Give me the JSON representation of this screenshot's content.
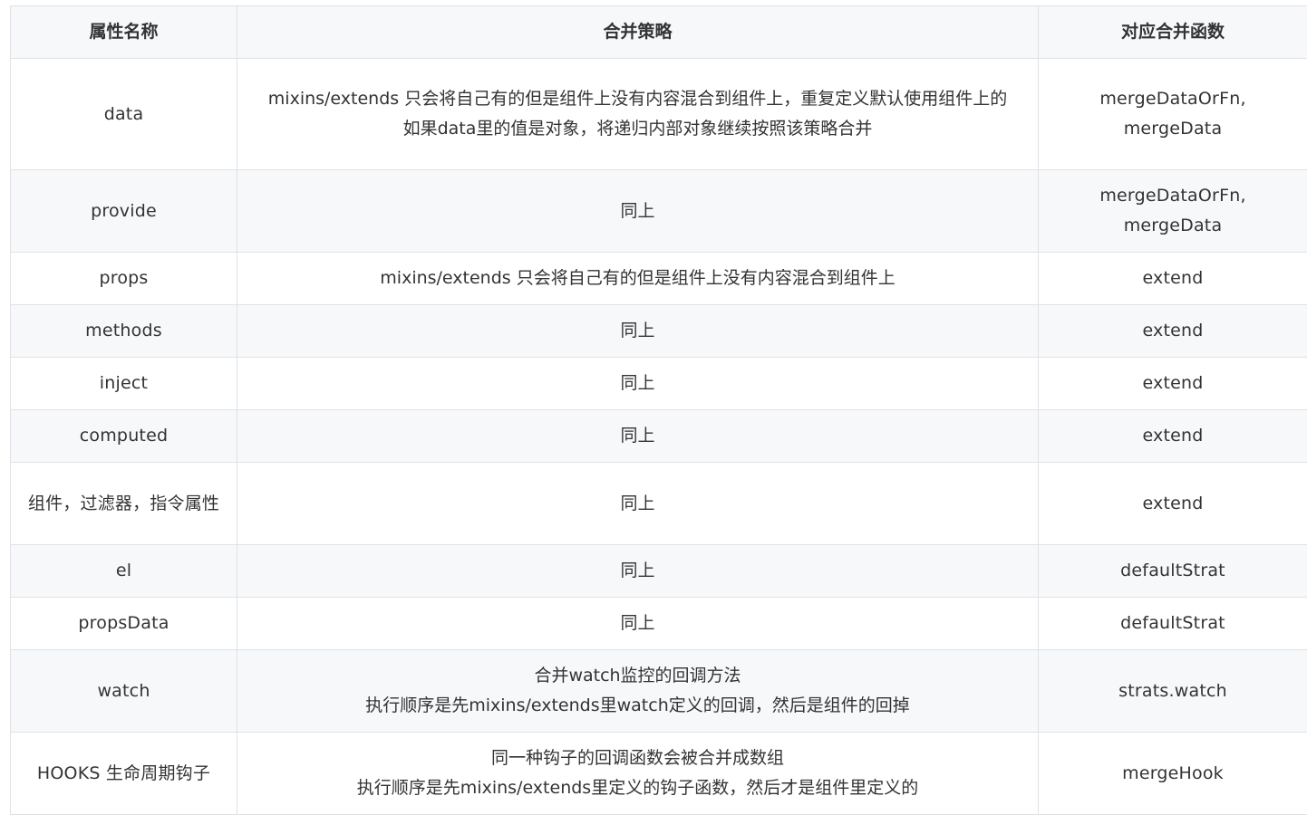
{
  "table": {
    "headers": [
      "属性名称",
      "合并策略",
      "对应合并函数"
    ],
    "rows": [
      {
        "name": "data",
        "strategy": [
          "mixins/extends 只会将自己有的但是组件上没有内容混合到组件上，重复定义默认使用组件上的",
          "如果data里的值是对象，将递归内部对象继续按照该策略合并"
        ],
        "fn": [
          "mergeDataOrFn,",
          "mergeData"
        ]
      },
      {
        "name": "provide",
        "strategy": [
          "同上"
        ],
        "fn": [
          "mergeDataOrFn,",
          "mergeData"
        ]
      },
      {
        "name": "props",
        "strategy": [
          "mixins/extends 只会将自己有的但是组件上没有内容混合到组件上"
        ],
        "fn": [
          "extend"
        ]
      },
      {
        "name": "methods",
        "strategy": [
          "同上"
        ],
        "fn": [
          "extend"
        ]
      },
      {
        "name": "inject",
        "strategy": [
          "同上"
        ],
        "fn": [
          "extend"
        ]
      },
      {
        "name": "computed",
        "strategy": [
          "同上"
        ],
        "fn": [
          "extend"
        ]
      },
      {
        "name": "组件，过滤器，指令属性",
        "strategy": [
          "同上"
        ],
        "fn": [
          "extend"
        ]
      },
      {
        "name": "el",
        "strategy": [
          "同上"
        ],
        "fn": [
          "defaultStrat"
        ]
      },
      {
        "name": "propsData",
        "strategy": [
          "同上"
        ],
        "fn": [
          "defaultStrat"
        ]
      },
      {
        "name": "watch",
        "strategy": [
          "合并watch监控的回调方法",
          "执行顺序是先mixins/extends里watch定义的回调，然后是组件的回掉"
        ],
        "fn": [
          "strats.watch"
        ]
      },
      {
        "name": "HOOKS 生命周期钩子",
        "strategy": [
          "同一种钩子的回调函数会被合并成数组",
          "执行顺序是先mixins/extends里定义的钩子函数，然后才是组件里定义的"
        ],
        "fn": [
          "mergeHook"
        ]
      }
    ]
  }
}
